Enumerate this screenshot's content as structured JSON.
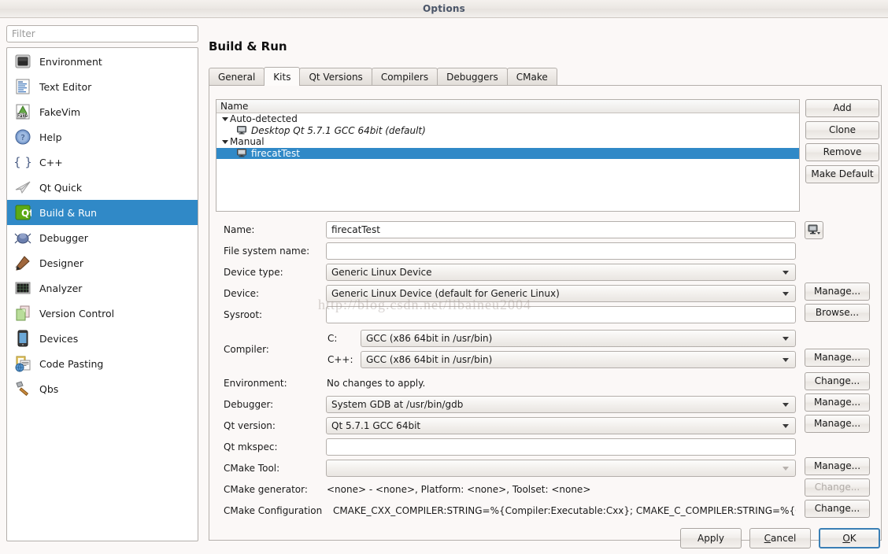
{
  "window": {
    "title": "Options"
  },
  "sidebar": {
    "filter_placeholder": "Filter",
    "items": [
      {
        "label": "Environment",
        "icon": "monitor-icon",
        "selected": false
      },
      {
        "label": "Text Editor",
        "icon": "text-document-icon",
        "selected": false
      },
      {
        "label": "FakeVim",
        "icon": "fakevim-icon",
        "selected": false
      },
      {
        "label": "Help",
        "icon": "question-mark-icon",
        "selected": false
      },
      {
        "label": "C++",
        "icon": "braces-icon",
        "selected": false
      },
      {
        "label": "Qt Quick",
        "icon": "paper-plane-icon",
        "selected": false
      },
      {
        "label": "Build & Run",
        "icon": "qt-logo-icon",
        "selected": true
      },
      {
        "label": "Debugger",
        "icon": "bug-icon",
        "selected": false
      },
      {
        "label": "Designer",
        "icon": "pen-ruler-icon",
        "selected": false
      },
      {
        "label": "Analyzer",
        "icon": "grid-chart-icon",
        "selected": false
      },
      {
        "label": "Version Control",
        "icon": "documents-icon",
        "selected": false
      },
      {
        "label": "Devices",
        "icon": "phone-icon",
        "selected": false
      },
      {
        "label": "Code Pasting",
        "icon": "clipboard-globe-icon",
        "selected": false
      },
      {
        "label": "Qbs",
        "icon": "hammer-icon",
        "selected": false
      }
    ]
  },
  "page": {
    "title": "Build & Run",
    "tabs": [
      {
        "label": "General",
        "active": false
      },
      {
        "label": "Kits",
        "active": true
      },
      {
        "label": "Qt Versions",
        "active": false
      },
      {
        "label": "Compilers",
        "active": false
      },
      {
        "label": "Debuggers",
        "active": false
      },
      {
        "label": "CMake",
        "active": false
      }
    ]
  },
  "kit_tree": {
    "header": "Name",
    "rows": [
      {
        "label": "Auto-detected",
        "level": 0,
        "expander": true,
        "device_icon": false,
        "italic": false,
        "selected": false
      },
      {
        "label": "Desktop Qt 5.7.1 GCC 64bit (default)",
        "level": 1,
        "expander": false,
        "device_icon": true,
        "italic": true,
        "selected": false
      },
      {
        "label": "Manual",
        "level": 0,
        "expander": true,
        "device_icon": false,
        "italic": false,
        "selected": false
      },
      {
        "label": "firecatTest",
        "level": 1,
        "expander": false,
        "device_icon": true,
        "italic": false,
        "selected": true
      }
    ]
  },
  "list_buttons": [
    {
      "label": "Add",
      "disabled": false
    },
    {
      "label": "Clone",
      "disabled": false
    },
    {
      "label": "Remove",
      "disabled": false
    },
    {
      "label": "Make Default",
      "disabled": false
    }
  ],
  "form": {
    "name": {
      "label": "Name:",
      "value": "firecatTest",
      "icon": "monitor-dropdown-icon"
    },
    "file_system_name": {
      "label": "File system name:",
      "value": ""
    },
    "device_type": {
      "label": "Device type:",
      "value": "Generic Linux Device"
    },
    "device": {
      "label": "Device:",
      "value": "Generic Linux Device (default for Generic Linux)",
      "button": "Manage..."
    },
    "sysroot": {
      "label": "Sysroot:",
      "value": "",
      "button": "Browse..."
    },
    "compiler": {
      "label": "Compiler:",
      "c_label": "C:",
      "c_value": "GCC (x86 64bit in /usr/bin)",
      "cxx_label": "C++:",
      "cxx_value": "GCC (x86 64bit in /usr/bin)",
      "button": "Manage..."
    },
    "environment": {
      "label": "Environment:",
      "value": "No changes to apply.",
      "button": "Change..."
    },
    "debugger": {
      "label": "Debugger:",
      "value": "System GDB at /usr/bin/gdb",
      "button": "Manage..."
    },
    "qt_version": {
      "label": "Qt version:",
      "value": "Qt 5.7.1 GCC 64bit",
      "button": "Manage..."
    },
    "qt_mkspec": {
      "label": "Qt mkspec:",
      "value": ""
    },
    "cmake_tool": {
      "label": "CMake Tool:",
      "value": "",
      "button": "Manage..."
    },
    "cmake_generator": {
      "label": "CMake generator:",
      "value": "<none> - <none>, Platform: <none>, Toolset: <none>",
      "button": "Change...",
      "button_disabled": true
    },
    "cmake_configuration": {
      "label": "CMake Configuration",
      "value": "CMAKE_CXX_COMPILER:STRING=%{Compiler:Executable:Cxx}; CMAKE_C_COMPILER:STRING=%{C...",
      "button": "Change..."
    }
  },
  "dialog_buttons": [
    {
      "label": "Apply",
      "mnemonic": "",
      "default": false
    },
    {
      "label": "Cancel",
      "mnemonic": "C",
      "default": false
    },
    {
      "label": "OK",
      "mnemonic": "O",
      "default": true
    }
  ],
  "watermark": {
    "text": "http://blog.csdn.net/libaineu2004"
  },
  "colors": {
    "selection": "#3089c7",
    "window_bg": "#fbf8f7",
    "field_bg": "#ffffff",
    "border": "#b4afab",
    "focus_ring": "#3a7fb5"
  }
}
